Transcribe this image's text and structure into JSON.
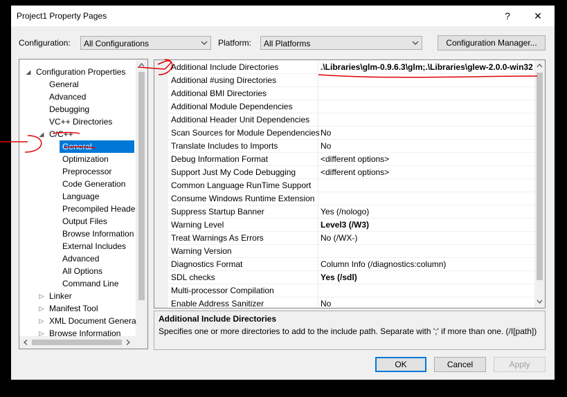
{
  "window": {
    "title": "Project1 Property Pages",
    "help_glyph": "?",
    "close_glyph": "✕"
  },
  "config_bar": {
    "configuration_label": "Configuration:",
    "configuration_value": "All Configurations",
    "platform_label": "Platform:",
    "platform_value": "All Platforms",
    "manager_button": "Configuration Manager..."
  },
  "tree": {
    "items": [
      {
        "label": "Configuration Properties",
        "expander": "expanded"
      },
      {
        "label": "General"
      },
      {
        "label": "Advanced"
      },
      {
        "label": "Debugging"
      },
      {
        "label": "VC++ Directories"
      },
      {
        "label": "C/C++",
        "expander": "expanded"
      },
      {
        "label": "General",
        "selected": true
      },
      {
        "label": "Optimization"
      },
      {
        "label": "Preprocessor"
      },
      {
        "label": "Code Generation"
      },
      {
        "label": "Language"
      },
      {
        "label": "Precompiled Heade"
      },
      {
        "label": "Output Files"
      },
      {
        "label": "Browse Information"
      },
      {
        "label": "External Includes"
      },
      {
        "label": "Advanced"
      },
      {
        "label": "All Options"
      },
      {
        "label": "Command Line"
      },
      {
        "label": "Linker",
        "expander": "collapsed"
      },
      {
        "label": "Manifest Tool",
        "expander": "collapsed"
      },
      {
        "label": "XML Document Genera",
        "expander": "collapsed"
      },
      {
        "label": "Browse Information",
        "expander": "collapsed"
      }
    ]
  },
  "properties": {
    "rows": [
      {
        "name": "Additional Include Directories",
        "value": ".\\Libraries\\glm-0.9.6.3\\glm;.\\Libraries\\glew-2.0.0-win32",
        "bold": true
      },
      {
        "name": "Additional #using Directories",
        "value": ""
      },
      {
        "name": "Additional BMI Directories",
        "value": ""
      },
      {
        "name": "Additional Module Dependencies",
        "value": ""
      },
      {
        "name": "Additional Header Unit Dependencies",
        "value": ""
      },
      {
        "name": "Scan Sources for Module Dependencies",
        "value": "No"
      },
      {
        "name": "Translate Includes to Imports",
        "value": "No"
      },
      {
        "name": "Debug Information Format",
        "value": "<different options>"
      },
      {
        "name": "Support Just My Code Debugging",
        "value": "<different options>"
      },
      {
        "name": "Common Language RunTime Support",
        "value": ""
      },
      {
        "name": "Consume Windows Runtime Extension",
        "value": ""
      },
      {
        "name": "Suppress Startup Banner",
        "value": "Yes (/nologo)"
      },
      {
        "name": "Warning Level",
        "value": "Level3 (/W3)",
        "bold": true
      },
      {
        "name": "Treat Warnings As Errors",
        "value": "No (/WX-)"
      },
      {
        "name": "Warning Version",
        "value": ""
      },
      {
        "name": "Diagnostics Format",
        "value": "Column Info (/diagnostics:column)"
      },
      {
        "name": "SDL checks",
        "value": "Yes (/sdl)",
        "bold": true
      },
      {
        "name": "Multi-processor Compilation",
        "value": ""
      },
      {
        "name": "Enable Address Sanitizer",
        "value": "No"
      }
    ]
  },
  "description": {
    "title": "Additional Include Directories",
    "text": "Specifies one or more directories to add to the include path. Separate with ';' if more than one. (/I[path])"
  },
  "buttons": {
    "ok": "OK",
    "cancel": "Cancel",
    "apply": "Apply"
  },
  "colors": {
    "selection": "#0078d7",
    "annotation_red": "#e00000"
  }
}
